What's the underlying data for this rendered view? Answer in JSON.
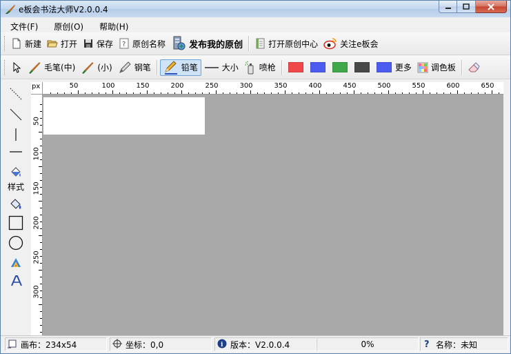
{
  "window": {
    "title": "e板会书法大师V2.0.0.4"
  },
  "menu": [
    "文件(F)",
    "原创(O)",
    "帮助(H)"
  ],
  "toolbar1": {
    "new": "新建",
    "open": "打开",
    "save": "保存",
    "original_name": "原创名称",
    "publish": "发布我的原创",
    "open_center": "打开原创中心",
    "follow": "关注e板会"
  },
  "toolbar2": {
    "brush_medium": "毛笔(中)",
    "brush_small": "(小)",
    "pen": "钢笔",
    "pencil": "铅笔",
    "size": "大小",
    "spray": "喷枪",
    "more": "更多",
    "palette": "调色板",
    "swatches": [
      "#f04848",
      "#4c5cf0",
      "#3ea84a",
      "#484848",
      "#4c5cf0"
    ]
  },
  "lefttools": {
    "style_label": "样式"
  },
  "ruler": {
    "unit": "px",
    "h_labels": [
      "50",
      "100",
      "150",
      "200",
      "250",
      "300",
      "350",
      "400",
      "450",
      "500",
      "550",
      "600",
      "650"
    ],
    "v_labels": [
      "50",
      "100",
      "150",
      "200",
      "250",
      "300"
    ]
  },
  "canvas": {
    "width": 234,
    "height": 54
  },
  "status": {
    "canvas": "画布：234x54",
    "coords": "坐标：0,0",
    "version": "版本：V2.0.0.4",
    "progress": "0%",
    "name": "名称：未知"
  },
  "colors": {
    "workspace": "#a9a9a9",
    "canvas": "#ffffff"
  }
}
